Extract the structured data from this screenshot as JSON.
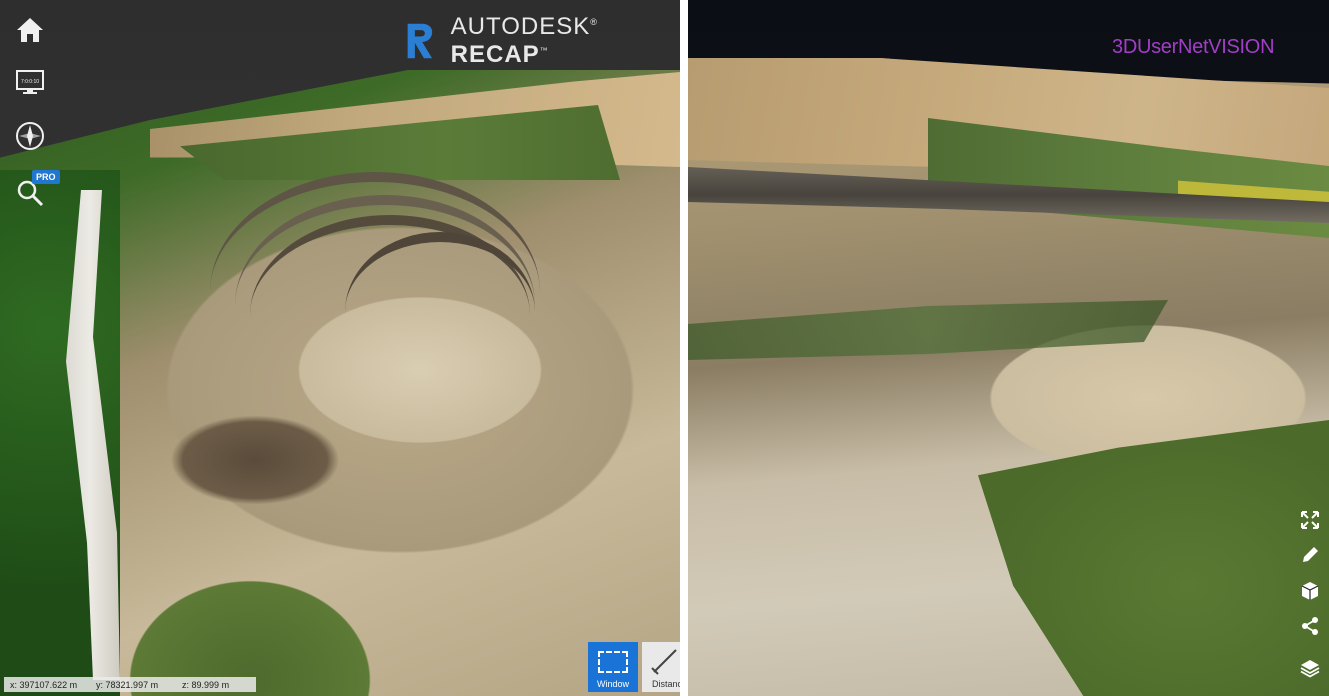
{
  "left_view": {
    "brand": {
      "autodesk": "AUTODESK",
      "product": "RECAP",
      "reg": "®",
      "tm": "™"
    },
    "toolbar": {
      "home_icon": "home-icon",
      "view_icon": "monitor-icon",
      "monitor_label": "7:0:0:10",
      "compass_icon": "compass-icon",
      "search_icon": "search-icon",
      "pro_badge": "PRO"
    },
    "coords": {
      "x_label": "x:",
      "x_value": "397107.622",
      "y_label": "y:",
      "y_value": "78321.997",
      "z_label": "z:",
      "z_value": "89.999",
      "unit": "m"
    },
    "tools": {
      "window_label": "Window",
      "distance_label": "Distanc"
    }
  },
  "right_view": {
    "brand": "3DUserNetVISION",
    "tools": [
      {
        "name": "fullscreen-icon"
      },
      {
        "name": "pencil-icon"
      },
      {
        "name": "cube-icon"
      },
      {
        "name": "share-icon"
      },
      {
        "name": "layers-icon"
      }
    ],
    "brand_color": "#a23ec6"
  },
  "colors": {
    "accent": "#1a73d6",
    "divider": "#ffffff"
  }
}
